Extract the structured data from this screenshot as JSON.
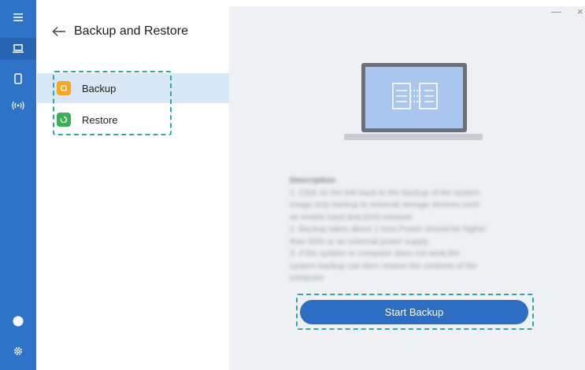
{
  "window": {
    "minimize_glyph": "—",
    "close_glyph": "×"
  },
  "rail": {
    "items": [
      {
        "icon": "hamburger-menu-icon"
      },
      {
        "icon": "laptop-icon",
        "active": true
      },
      {
        "icon": "phone-icon"
      },
      {
        "icon": "wireless-signal-icon"
      },
      {
        "icon": "user-avatar-icon"
      },
      {
        "icon": "gear-icon"
      }
    ]
  },
  "sidebar": {
    "title": "Backup and Restore",
    "items": [
      {
        "label": "Backup",
        "icon": "backup-icon",
        "selected": true,
        "color": "#f5a623"
      },
      {
        "label": "Restore",
        "icon": "restore-icon",
        "selected": false,
        "color": "#3fae5a"
      }
    ]
  },
  "main": {
    "description_title": "Description",
    "description_lines": [
      "1. Click on the link back to the backup of the system",
      "image,only backup to external storage devices,such",
      "as mobile hard disk,DVD,network",
      "2. Backup takes about 1 hour,Power should be higher",
      "than 50% or an external power supply",
      "3. If the system or computer does not work,the",
      "system backup can then restore the contents of the",
      "computer"
    ],
    "start_button": "Start Backup"
  },
  "colors": {
    "accent": "#2f73c9",
    "button": "#2d6ec4",
    "highlight_dash": "#34a6a3",
    "selected_row": "#d9e8f7"
  }
}
